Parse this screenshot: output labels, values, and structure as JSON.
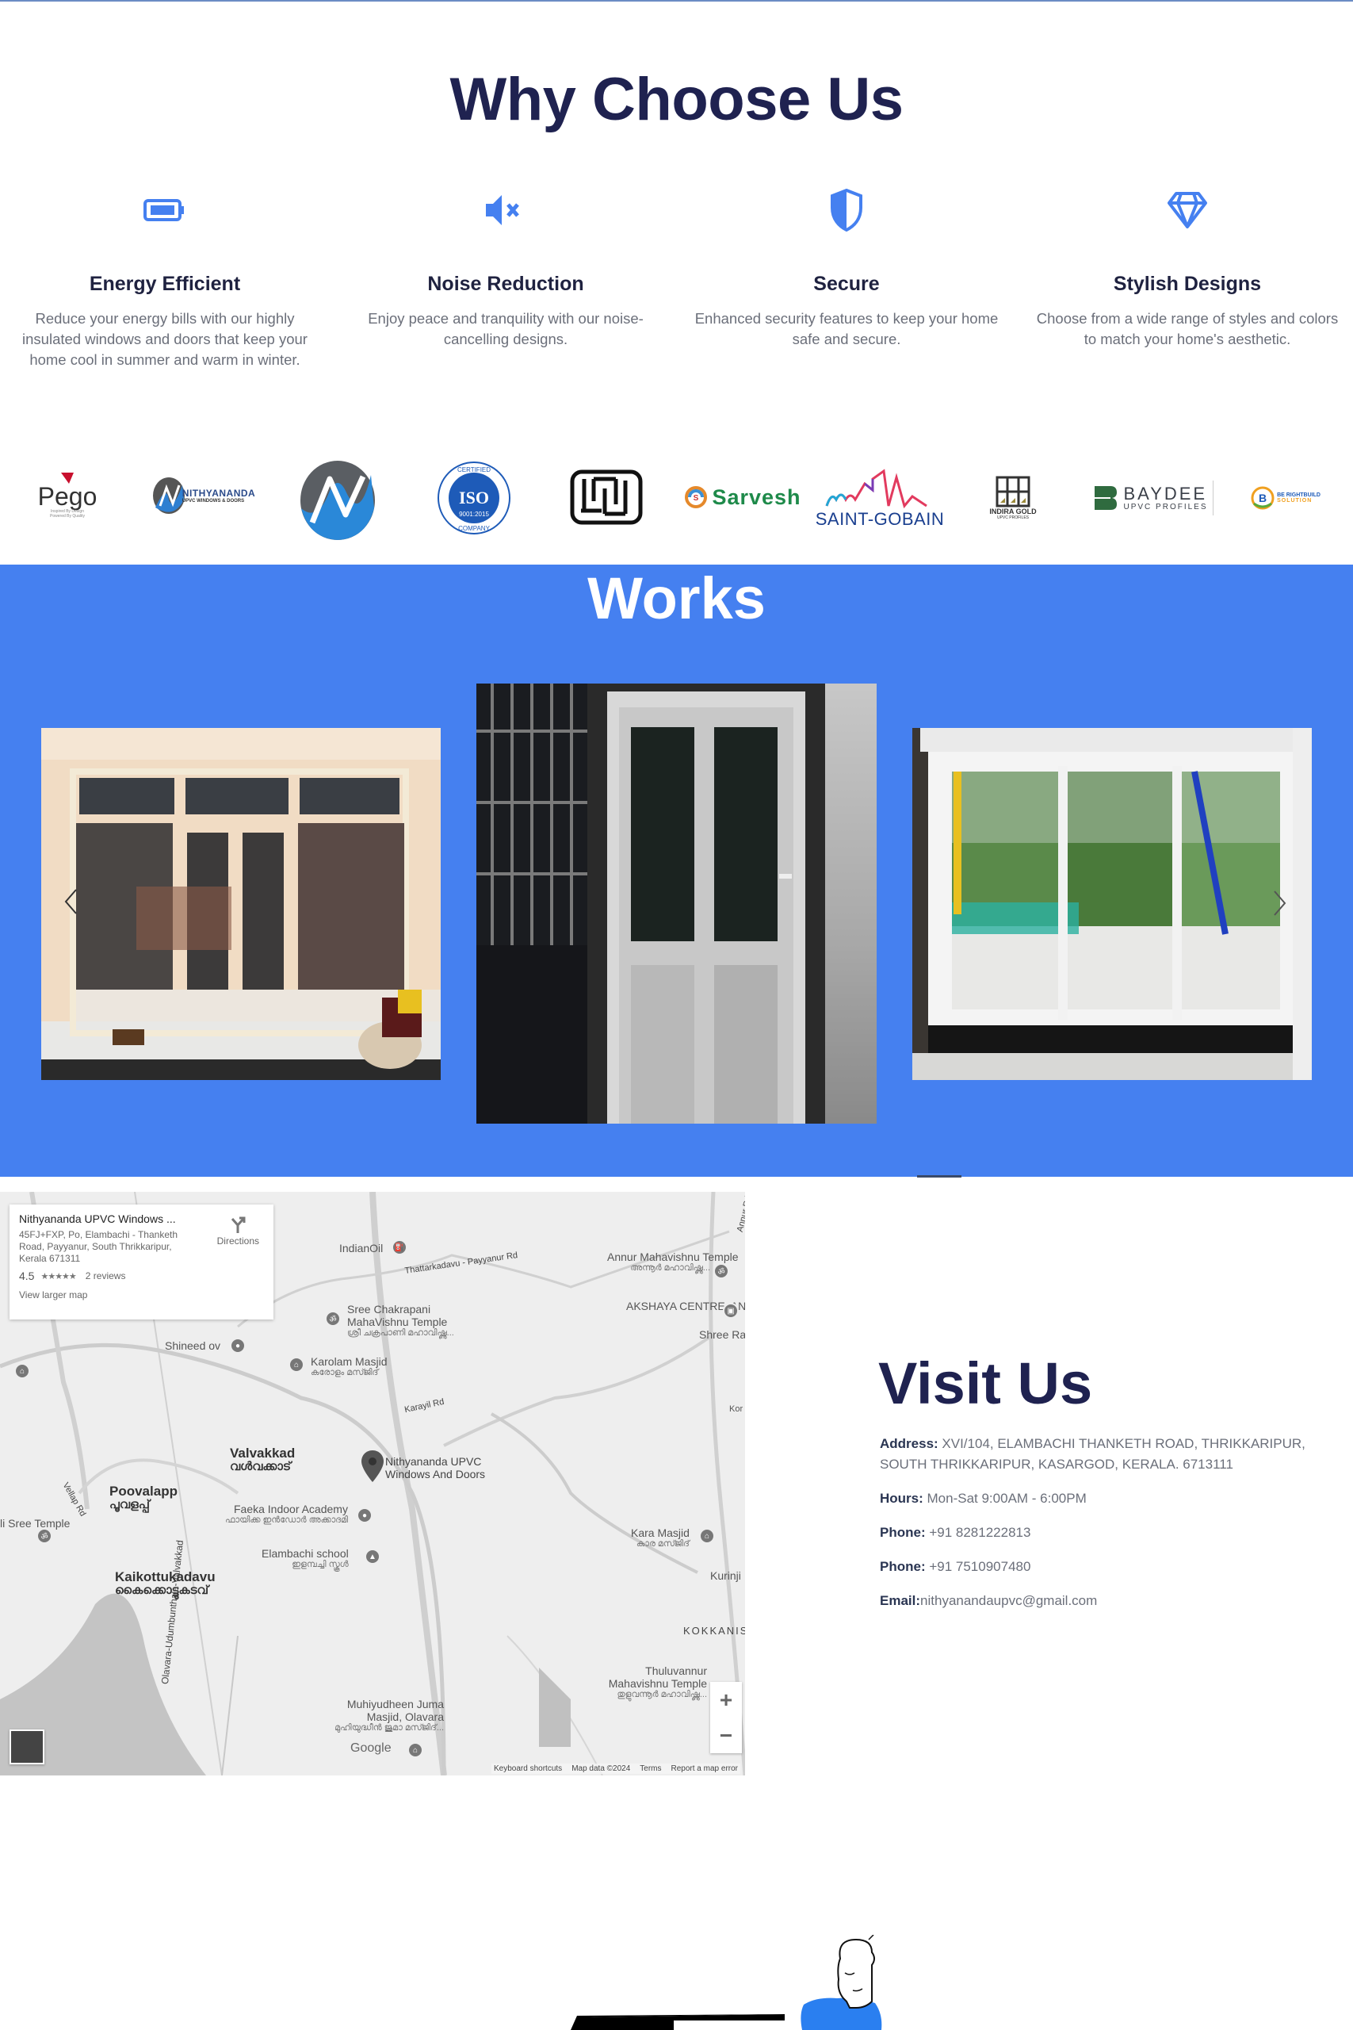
{
  "why": {
    "title": "Why Choose Us",
    "accent_color": "#4580f0",
    "features": [
      {
        "icon": "battery-icon",
        "title": "Energy Efficient",
        "description": "Reduce your energy bills with our highly insulated windows and doors that keep your home cool in summer and warm in winter."
      },
      {
        "icon": "mute-speaker-icon",
        "title": "Noise Reduction",
        "description": "Enjoy peace and tranquility with our noise-cancelling designs."
      },
      {
        "icon": "shield-icon",
        "title": "Secure",
        "description": "Enhanced security features to keep your home safe and secure."
      },
      {
        "icon": "diamond-icon",
        "title": "Stylish Designs",
        "description": "Choose from a wide range of styles and colors to match your home's aesthetic."
      }
    ]
  },
  "logos": [
    {
      "name": "Pego",
      "tagline1": "Inspired By Design",
      "tagline2": "Powered By Quality"
    },
    {
      "name": "NITHYANANDA",
      "sub": "UPVC WINDOWS & DOORS"
    },
    {
      "name": "N-logo"
    },
    {
      "name": "ISO",
      "top": "CERTIFIED",
      "mid": "9001:2015",
      "bottom": "COMPANY"
    },
    {
      "name": "ISI"
    },
    {
      "name": "Sarvesh"
    },
    {
      "name": "SAINT-GOBAIN"
    },
    {
      "name": "INDIRA GOLD",
      "sub": "UPVC PROFILES"
    },
    {
      "name": "BAYDEE",
      "sub": "UPVC PROFILES"
    },
    {
      "name": "BE RIGHTBUILD",
      "sub": "SOLUTION"
    }
  ],
  "works": {
    "title": "Works",
    "background": "#4580f0",
    "images": [
      {
        "alt": "French doors with transom windows"
      },
      {
        "alt": "White UPVC door with glass panels"
      },
      {
        "alt": "Sliding UPVC window"
      }
    ]
  },
  "map": {
    "card": {
      "title": "Nithyananda UPVC Windows ...",
      "address": "45FJ+FXP, Po, Elambachi - Thanketh Road, Payyanur, South Thrikkaripur, Kerala 671311",
      "rating": "4.5",
      "stars": "★★★★★",
      "reviews": "2 reviews",
      "view_larger": "View larger map",
      "directions": "Directions"
    },
    "labels": {
      "indianoil": "IndianOil",
      "road1": "Thattarkadavu - Payyanur Rd",
      "annur_temple": "Annur Mahavishnu Temple",
      "annur_temple_ml": "അന്നൂർ മഹാവിഷ്ണു...",
      "akshaya": "AKSHAYA CENTRE, ANNUR",
      "shree": "Shree Ra",
      "annur_rd": "Annur Rd",
      "chakrapani": "Sree Chakrapani MahaVishnu Temple",
      "chakrapani_ml": "ശ്രീ ചക്രപാണി മഹാവിഷ്ണു...",
      "shineed": "Shineed ov",
      "karolam": "Karolam Masjid",
      "karolam_ml": "കരോളം മസ്ജിദ്",
      "karayil": "Karayil Rd",
      "valvakkad": "Valvakkad",
      "valvakkad_ml": "വൾവക്കാട്",
      "pin_label": "Nithyananda UPVC Windows And Doors",
      "poovalapp": "Poovalapp",
      "poovalapp_ml": "പൂവളപ്പ്",
      "vellap": "Vellap Rd",
      "faeka": "Faeka Indoor Academy",
      "faeka_ml": "ഫായിക്ക ഇൻഡോർ അക്കാദമി",
      "elambachi": "Elambachi school",
      "elambachi_ml": "ഇളമ്പച്ചി സ്കൂൾ",
      "kaikottu": "Kaikottukadavu",
      "kaikottu_ml": "കൈക്കൊട്ടുകടവ്",
      "kara": "Kara Masjid",
      "kara_ml": "കാര മസ്ജിദ്",
      "kurinji": "Kurinji",
      "kokkanis": "KOKKANIS",
      "thuluvannur": "Thuluvannur Mahavishnu Temple",
      "thuluvannur_ml": "തുളുവന്നൂർ മഹാവിഷ്ണു...",
      "udumbunthala": "Olavara-Udumbunthala-Valvakkad",
      "muhiyudheen": "Muhiyudheen Juma Masjid, Olavara",
      "muhiyudheen_ml": "മുഹിയുദ്ധീൻ ജുമാ മസ്ജിദ്...",
      "sree_left": "li Sree Temple",
      "kor": "Kor"
    },
    "zoom_in": "+",
    "zoom_out": "−",
    "google": "Google",
    "footer": [
      "Keyboard shortcuts",
      "Map data ©2024",
      "Terms",
      "Report a map error"
    ]
  },
  "visit": {
    "title": "Visit Us",
    "rows": [
      {
        "label": "Address:",
        "value": " XVI/104, ELAMBACHI THANKETH ROAD, THRIKKARIPUR, SOUTH THRIKKARIPUR, KASARGOD, KERALA. 6713111"
      },
      {
        "label": "Hours:",
        "value": " Mon-Sat 9:00AM - 6:00PM"
      },
      {
        "label": "Phone:",
        "value": " +91 8281222813"
      },
      {
        "label": "Phone:",
        "value": " +91 7510907480"
      },
      {
        "label": "Email:",
        "value": "nithyanandaupvc@gmail.com"
      }
    ]
  }
}
